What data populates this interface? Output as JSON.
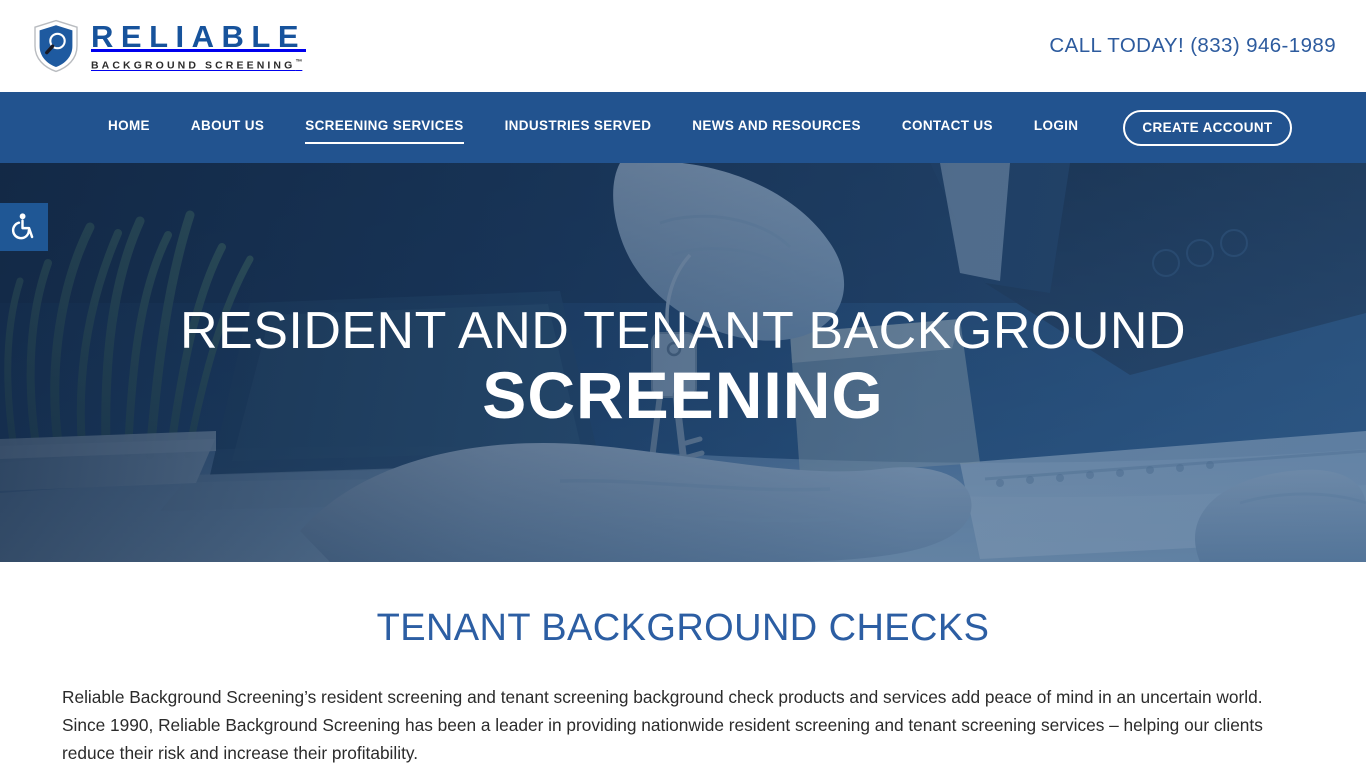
{
  "brand": {
    "logo_icon": "shield-magnifier-icon",
    "name": "RELIABLE",
    "tagline": "BACKGROUND SCREENING",
    "trademark": "™",
    "primary_color": "#17539c",
    "nav_bg_color": "#22538f",
    "accent_color": "#2c5ea3"
  },
  "header": {
    "phone_label": "CALL TODAY!",
    "phone_number": "(833) 946-1989"
  },
  "nav": {
    "items": [
      {
        "label": "HOME",
        "active": false
      },
      {
        "label": "ABOUT US",
        "active": false
      },
      {
        "label": "SCREENING SERVICES",
        "active": true
      },
      {
        "label": "INDUSTRIES SERVED",
        "active": false
      },
      {
        "label": "NEWS AND RESOURCES",
        "active": false
      },
      {
        "label": "CONTACT US",
        "active": false
      },
      {
        "label": "LOGIN",
        "active": false
      }
    ],
    "cta_label": "CREATE ACCOUNT"
  },
  "accessibility": {
    "icon": "wheelchair-accessibility-icon",
    "bg_color": "#1f5795"
  },
  "hero": {
    "title_line1": "RESIDENT AND TENANT BACKGROUND",
    "title_line2": "SCREENING",
    "image_description": "hands exchanging keys over a desk with laptop and potted plant"
  },
  "main": {
    "section_title": "TENANT BACKGROUND CHECKS",
    "intro_paragraph": "Reliable Background Screening’s resident screening and tenant screening background check products and services add peace of mind in an uncertain world. Since 1990, Reliable Background Screening has been a leader in providing nationwide resident screening and tenant screening services – helping our clients reduce their risk and increase their profitability."
  }
}
